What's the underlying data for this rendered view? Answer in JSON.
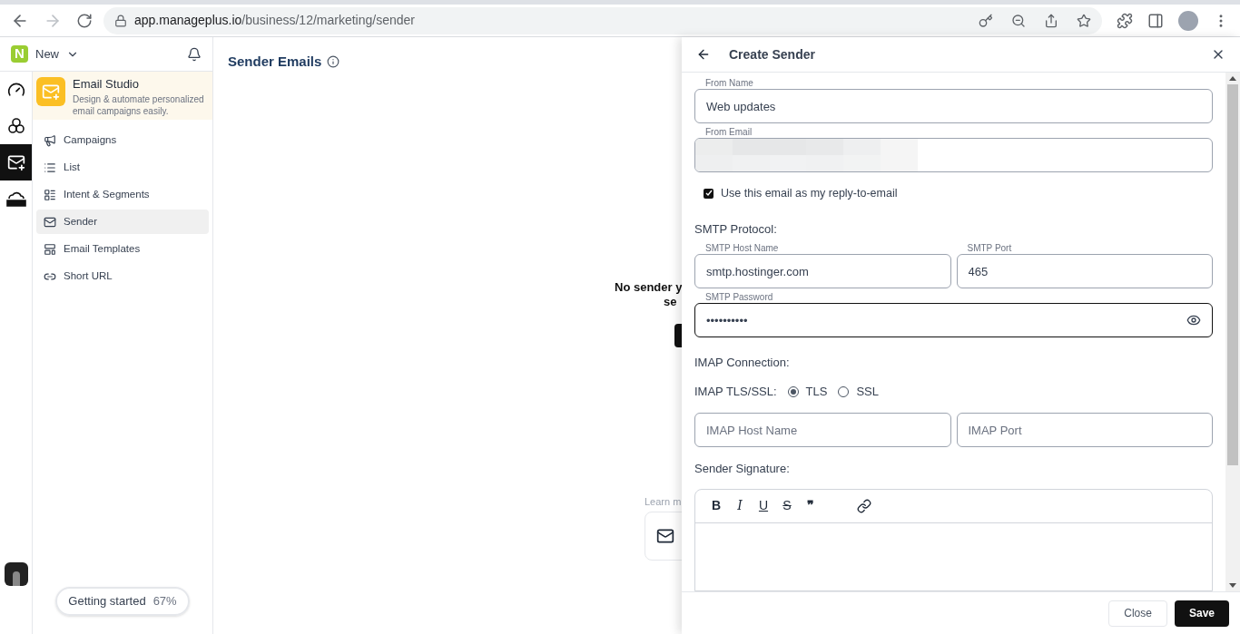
{
  "browser": {
    "url_host": "app.manageplus.io",
    "url_path": "/business/12/marketing/sender"
  },
  "workspace": {
    "logo": "N",
    "name": "New"
  },
  "rail": [
    {
      "kind": "speed",
      "selected": false
    },
    {
      "kind": "circles",
      "selected": false
    },
    {
      "kind": "mail",
      "selected": true
    },
    {
      "kind": "crm",
      "selected": false
    }
  ],
  "studio": {
    "title": "Email Studio",
    "subtitle": "Design & automate personalized email campaigns easily."
  },
  "nav": [
    {
      "label": "Campaigns",
      "kind": "megaphone",
      "selected": false
    },
    {
      "label": "List",
      "kind": "list",
      "selected": false
    },
    {
      "label": "Intent & Segments",
      "kind": "segments",
      "selected": false
    },
    {
      "label": "Sender",
      "kind": "mail",
      "selected": true
    },
    {
      "label": "Email Templates",
      "kind": "template",
      "selected": false
    },
    {
      "label": "Short URL",
      "kind": "link",
      "selected": false
    }
  ],
  "getting_started": {
    "label": "Getting started",
    "percent": "67%"
  },
  "main": {
    "title": "Sender Emails",
    "empty_line_1": "No sender y",
    "empty_line_2": "se",
    "learn": "Learn m"
  },
  "panel": {
    "title": "Create Sender",
    "from_name": {
      "label": "From Name",
      "value": "Web updates"
    },
    "from_email": {
      "label": "From Email",
      "redacted": true
    },
    "reply_to": {
      "label": "Use this email as my reply-to-email",
      "checked": true
    },
    "smtp_heading": "SMTP Protocol:",
    "smtp_host": {
      "label": "SMTP Host Name",
      "value": "smtp.hostinger.com"
    },
    "smtp_port": {
      "label": "SMTP Port",
      "value": "465"
    },
    "smtp_password": {
      "label": "SMTP Password",
      "value": "••••••••••"
    },
    "imap_heading": "IMAP Connection:",
    "imap_tls_label": "IMAP TLS/SSL:",
    "imap_options": [
      {
        "label": "TLS",
        "selected": true
      },
      {
        "label": "SSL",
        "selected": false
      }
    ],
    "imap_host": {
      "placeholder": "IMAP Host Name"
    },
    "imap_port": {
      "placeholder": "IMAP Port"
    },
    "signature_heading": "Sender Signature:",
    "toolbar": [
      {
        "kind": "bold",
        "label": "B"
      },
      {
        "kind": "italic",
        "label": "I"
      },
      {
        "kind": "underline",
        "label": "U"
      },
      {
        "kind": "strike",
        "label": "S"
      },
      {
        "kind": "quote",
        "label": "❞"
      },
      {
        "kind": "link"
      }
    ],
    "buttons": [
      {
        "label": "Close",
        "kind": "secondary"
      },
      {
        "label": "Save",
        "kind": "primary"
      }
    ]
  }
}
